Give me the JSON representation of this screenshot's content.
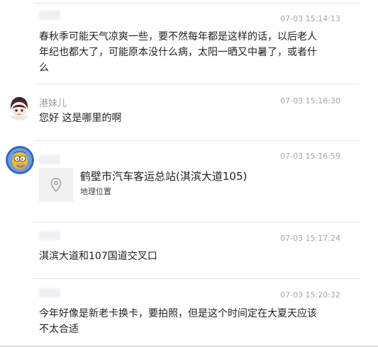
{
  "messages": [
    {
      "time": "07-03 15:14:13",
      "text": "春秋季可能天气凉爽一些，要不然每年都是这样的话，以后老人年纪也都大了，可能原本没什么病，太阳一晒又中暑了，或者什么"
    },
    {
      "name": "港妹儿",
      "time": "07-03 15:16:30",
      "text": "您好 这是哪里的啊"
    },
    {
      "time": "07-03 15:16:59",
      "location": {
        "title": "鹤壁市汽车客运总站(淇滨大道105)",
        "subtitle": "地理位置"
      }
    },
    {
      "time": "07-03 15:17:24",
      "text": "淇滨大道和107国道交叉口"
    },
    {
      "time": "07-03 15:20:32",
      "text": "今年好像是新老卡换卡，要拍照，但是这个时间定在大夏天应该不太合适"
    }
  ],
  "icons": {
    "avatar_1": "anime-girl-avatar",
    "avatar_2": "cartoon-character-avatar",
    "location": "map-pin-icon"
  },
  "colors": {
    "timestamp": "#a6a6a6",
    "name": "#9a9a9a",
    "text": "#222222",
    "divider": "#e6e6e6",
    "location_box": "#f1f1f1"
  }
}
